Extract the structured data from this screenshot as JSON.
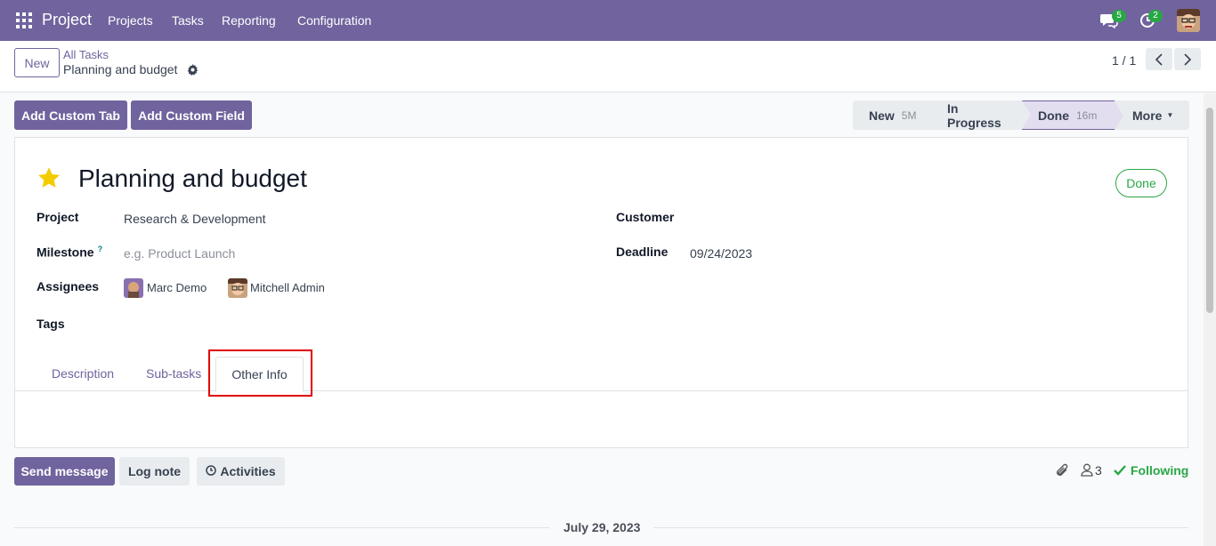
{
  "app": {
    "title": "Project"
  },
  "nav": {
    "items": [
      "Projects",
      "Tasks",
      "Reporting",
      "Configuration"
    ]
  },
  "systray": {
    "messages_count": "5",
    "activities_count": "2"
  },
  "control_panel": {
    "new_label": "New",
    "breadcrumb_parent": "All Tasks",
    "breadcrumb_current": "Planning and budget",
    "pager": "1 / 1"
  },
  "actions": {
    "add_custom_tab": "Add Custom Tab",
    "add_custom_field": "Add Custom Field"
  },
  "statusbar": {
    "stages": [
      {
        "label": "New",
        "duration": "5M"
      },
      {
        "label": "In Progress",
        "duration": ""
      },
      {
        "label": "Done",
        "duration": "16m"
      }
    ],
    "more_label": "More"
  },
  "task": {
    "title": "Planning and budget",
    "state_badge": "Done",
    "fields": {
      "project_label": "Project",
      "project_value": "Research & Development",
      "milestone_label": "Milestone",
      "milestone_help": "?",
      "milestone_placeholder": "e.g. Product Launch",
      "assignees_label": "Assignees",
      "assignees": [
        "Marc Demo",
        "Mitchell Admin"
      ],
      "tags_label": "Tags",
      "customer_label": "Customer",
      "deadline_label": "Deadline",
      "deadline_value": "09/24/2023"
    }
  },
  "tabs": {
    "description": "Description",
    "subtasks": "Sub-tasks",
    "other_info": "Other Info"
  },
  "chatter": {
    "send_message": "Send message",
    "log_note": "Log note",
    "activities": "Activities",
    "followers_count": "3",
    "following": "Following",
    "date_separator": "July 29, 2023"
  },
  "colors": {
    "brand": "#71639e",
    "success": "#28a745",
    "highlight": "#e00000"
  }
}
